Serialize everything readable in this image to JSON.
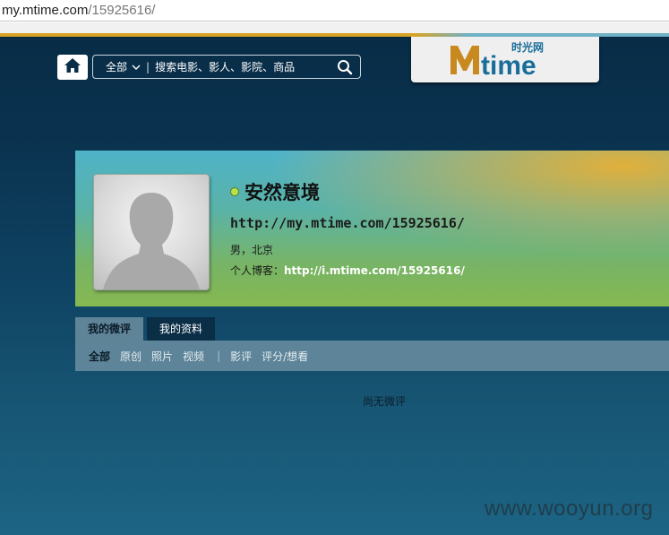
{
  "browser": {
    "url_domain": "my.mtime.com",
    "url_path": "/15925616/"
  },
  "header": {
    "search_scope": "全部",
    "search_placeholder": "搜索电影、影人、影院、商品",
    "logo_text": "Mtime",
    "logo_cn": "时光网",
    "brand_color": "#c8891f",
    "logo_blue": "#1a6d9a"
  },
  "profile": {
    "username": "安然意境",
    "url": "http://my.mtime.com/15925616/",
    "info": "男，北京",
    "blog_label": "个人博客：",
    "blog_url": "http://i.mtime.com/15925616/",
    "status_color": "#b6e34a"
  },
  "tabs": [
    {
      "label": "我的微评",
      "active": true
    },
    {
      "label": "我的资料",
      "active": false
    }
  ],
  "filters": {
    "all": "全部",
    "original": "原创",
    "photos": "照片",
    "videos": "视频",
    "separator": "|",
    "reviews": "影评",
    "ratings": "评分/想看"
  },
  "content": {
    "empty_text": "尚无微评"
  },
  "watermark": "www.wooyun.org"
}
